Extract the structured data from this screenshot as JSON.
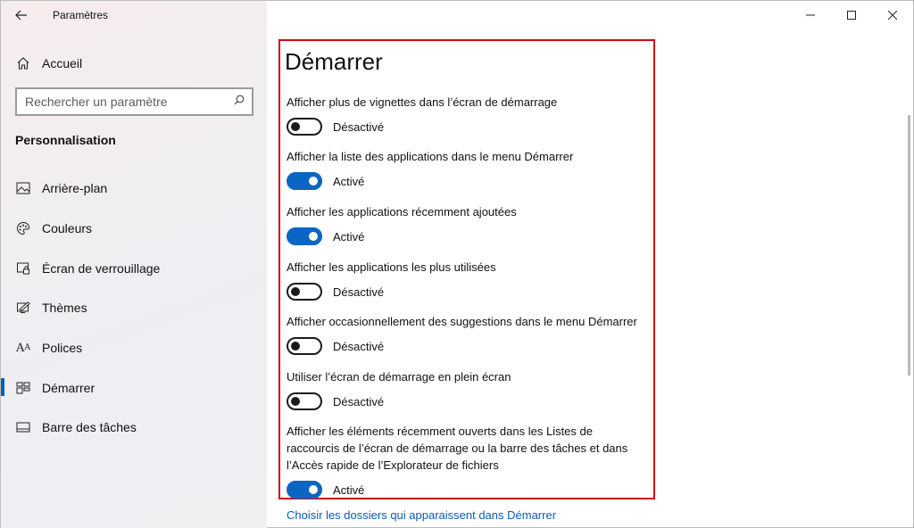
{
  "window": {
    "title": "Paramètres",
    "controls": {
      "minimize": "—",
      "maximize": "☐",
      "close": "✕"
    }
  },
  "sidebar": {
    "back_icon": "arrow-left-icon",
    "home_label": "Accueil",
    "search": {
      "placeholder": "Rechercher un paramètre"
    },
    "section_title": "Personnalisation",
    "items": [
      {
        "label": "Arrière-plan",
        "icon": "image-icon",
        "selected": false
      },
      {
        "label": "Couleurs",
        "icon": "palette-icon",
        "selected": false
      },
      {
        "label": "Écran de verrouillage",
        "icon": "lock-screen-icon",
        "selected": false
      },
      {
        "label": "Thèmes",
        "icon": "themes-icon",
        "selected": false
      },
      {
        "label": "Polices",
        "icon": "fonts-icon",
        "selected": false
      },
      {
        "label": "Démarrer",
        "icon": "start-icon",
        "selected": true
      },
      {
        "label": "Barre des tâches",
        "icon": "taskbar-icon",
        "selected": false
      }
    ]
  },
  "main": {
    "title": "Démarrer",
    "settings": [
      {
        "label": "Afficher plus de vignettes dans l’écran de démarrage",
        "state": "Désactivé",
        "on": false
      },
      {
        "label": "Afficher la liste des applications dans le menu Démarrer",
        "state": "Activé",
        "on": true
      },
      {
        "label": "Afficher les applications récemment ajoutées",
        "state": "Activé",
        "on": true
      },
      {
        "label": "Afficher les applications les plus utilisées",
        "state": "Désactivé",
        "on": false
      },
      {
        "label": "Afficher occasionnellement des suggestions dans le menu Démarrer",
        "state": "Désactivé",
        "on": false
      },
      {
        "label": "Utiliser l’écran de démarrage en plein écran",
        "state": "Désactivé",
        "on": false
      },
      {
        "label": "Afficher les éléments récemment ouverts dans les Listes de raccourcis de l’écran de démarrage ou la barre des tâches et dans l’Accès rapide de l’Explorateur de fichiers",
        "state": "Activé",
        "on": true
      }
    ],
    "link": "Choisir les dossiers qui apparaissent dans Démarrer"
  },
  "colors": {
    "accent": "#0a66c2",
    "highlight_border": "#d0021b",
    "link": "#0a5cb8"
  }
}
